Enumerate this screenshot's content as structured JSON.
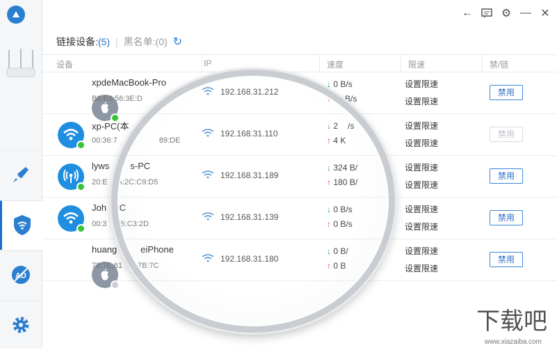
{
  "tabs": {
    "connected_label": "链接设备:",
    "connected_count": "(5)",
    "blacklist_label": "黑名单:(0)"
  },
  "table": {
    "col_device": "设备",
    "col_ip": "IP",
    "col_speed": "速度",
    "col_limit": "限速",
    "col_ban": "禁/链"
  },
  "devices": [
    {
      "name": "xpdeMacBook-Pro",
      "mac": "B8:E8:56:3E:D",
      "ip": "192.168.31.212",
      "down": "0 B/s",
      "up": "24 B/s",
      "limit_down": "设置限速",
      "limit_up": "设置限速",
      "button": "禁用"
    },
    {
      "name": "xp-PC(本",
      "mac": "00:36:7",
      "ip": "192.168.31.110",
      "down": "2",
      "up": "4 K",
      "limit_down": "设置限速",
      "limit_up": "设置限速",
      "button": "禁用"
    },
    {
      "name": "lyws",
      "mac": "20:E",
      "ip": "192.168.31.189",
      "down": "324 B/",
      "up": "180 B/",
      "limit_down": "设置限速",
      "limit_up": "设置限速",
      "button": "禁用"
    },
    {
      "name": "Joh",
      "mac": "00:3",
      "ip": "192.168.31.139",
      "down": "0 B/s",
      "up": "0 B/s",
      "limit_down": "设置限速",
      "limit_up": "设置限速",
      "button": "禁用"
    },
    {
      "name": "huang",
      "mac": "78:7E:61",
      "ip": "192.168.31.180",
      "down": "0 B/",
      "up": "0 B",
      "limit_down": "设置限速",
      "limit_up": "设置限速",
      "button": "禁用"
    }
  ],
  "device_name_tails": [
    "",
    "",
    "s-PC",
    "PC",
    "eiPhone"
  ],
  "device_mac_tails": [
    "",
    "89:DE",
    "A:2C:C9:D5",
    "45:C3:2D",
    "7B:7C"
  ],
  "speed_tails_down": [
    "",
    "/s",
    "",
    "",
    ""
  ],
  "speed_tails_up": [
    "",
    "",
    "",
    "",
    ""
  ],
  "sidebar": {
    "items": [
      "speed-boost",
      "security",
      "ad-block",
      "settings"
    ]
  },
  "watermark": "下载吧",
  "watermark_url": "www.xiazaiba.com",
  "colors": {
    "accent": "#1f6fc8",
    "download": "#2ea84b",
    "upload": "#e04848",
    "online": "#39c23a"
  }
}
